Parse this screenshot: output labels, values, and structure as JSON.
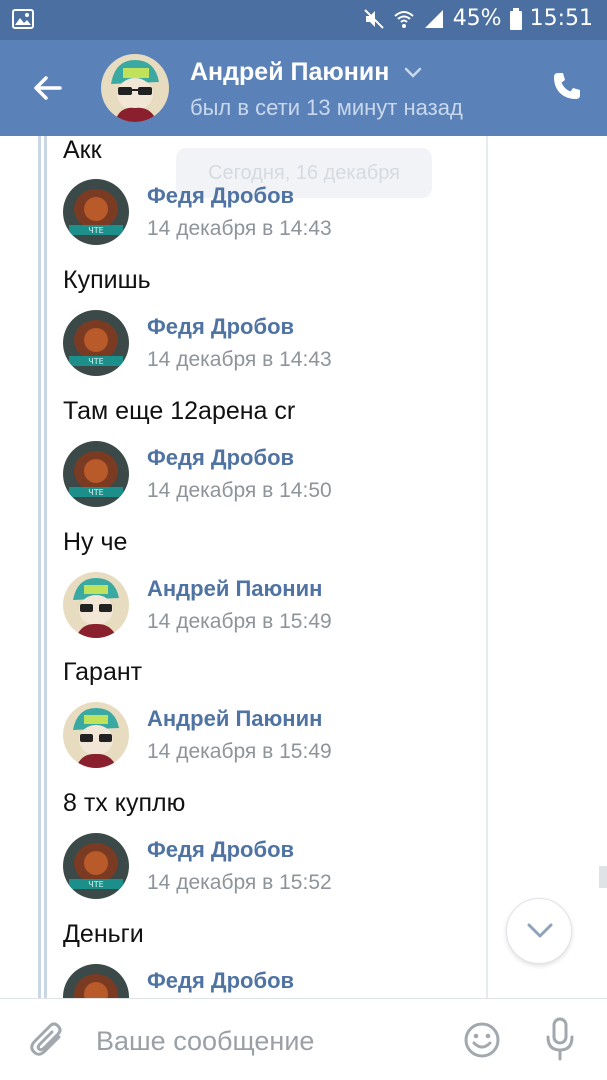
{
  "status_bar": {
    "battery": "45%",
    "time": "15:51"
  },
  "header": {
    "name": "Андрей Паюнин",
    "status": "был в сети 13 минут назад"
  },
  "chat": {
    "date_divider": "Сегодня, 16 декабря",
    "forwarded": [
      {
        "type": "text",
        "text": "Акк"
      },
      {
        "type": "head",
        "author": "Федя Дробов",
        "date": "14 декабря в 14:43",
        "avatar": "fedya-avatar"
      },
      {
        "type": "text",
        "text": "Купишь"
      },
      {
        "type": "head",
        "author": "Федя Дробов",
        "date": "14 декабря в 14:43",
        "avatar": "fedya-avatar"
      },
      {
        "type": "text",
        "text": "Там еще 12арена cr"
      },
      {
        "type": "head",
        "author": "Федя Дробов",
        "date": "14 декабря в 14:50",
        "avatar": "fedya-avatar"
      },
      {
        "type": "text",
        "text": "Ну че"
      },
      {
        "type": "head",
        "author": "Андрей Паюнин",
        "date": "14 декабря в 15:49",
        "avatar": "andrey-avatar"
      },
      {
        "type": "text",
        "text": "Гарант"
      },
      {
        "type": "head",
        "author": "Андрей Паюнин",
        "date": "14 декабря в 15:49",
        "avatar": "andrey-avatar"
      },
      {
        "type": "text",
        "text": "8 тх куплю"
      },
      {
        "type": "head",
        "author": "Федя Дробов",
        "date": "14 декабря в 15:52",
        "avatar": "fedya-avatar"
      },
      {
        "type": "text",
        "text": "Деньги"
      },
      {
        "type": "head",
        "author": "Федя Дробов",
        "date": "",
        "avatar": "fedya-avatar"
      }
    ]
  },
  "composer": {
    "placeholder": "Ваше сообщение"
  },
  "icons": {
    "gallery": "image-icon",
    "mute": "mute-icon",
    "wifi": "wifi-icon",
    "signal": "signal-icon",
    "battery": "battery-icon",
    "back": "back-arrow-icon",
    "chevron": "chevron-down-icon",
    "call": "phone-icon",
    "scroll": "scroll-down-icon",
    "attach": "paperclip-icon",
    "emoji": "emoji-icon",
    "mic": "microphone-icon"
  },
  "colors": {
    "status_bar": "#4a6fa0",
    "header": "#5b82b8",
    "author_name": "#4f73a2",
    "date_text": "#8e9499"
  }
}
